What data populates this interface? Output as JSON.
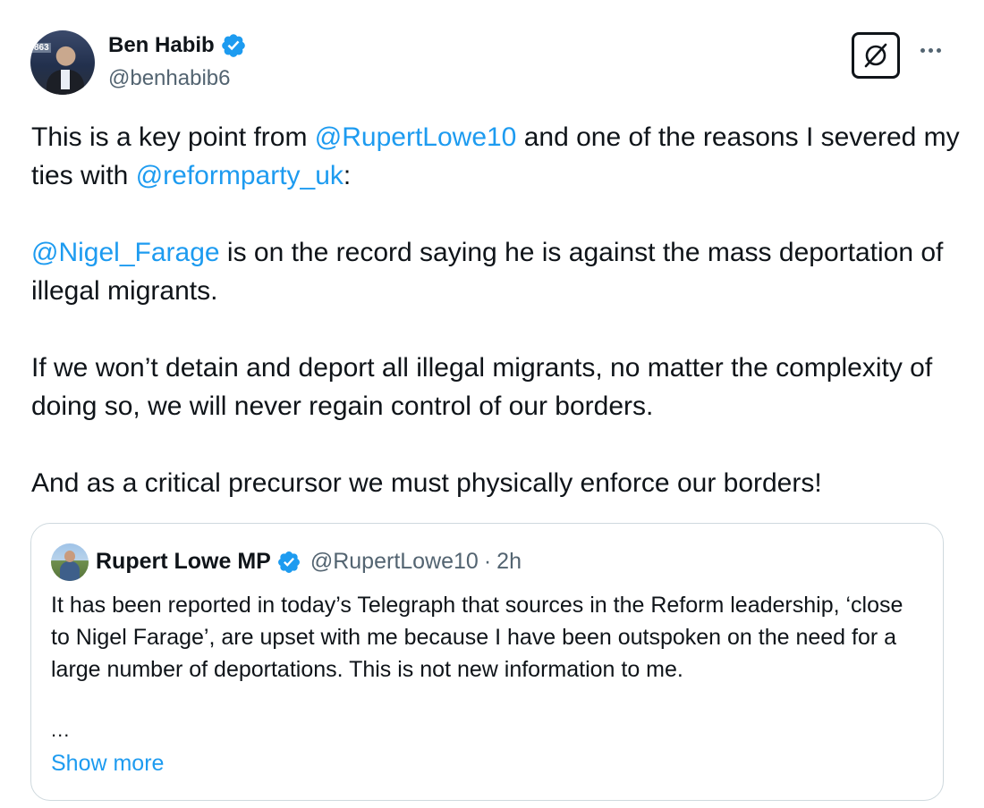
{
  "author": {
    "display_name": "Ben Habib",
    "handle": "@benhabib6",
    "avatar_icon": "profile-photo",
    "avatar_badge": "863",
    "verified_icon": "verified-badge-icon",
    "verified_color": "#1d9bf0"
  },
  "actions": {
    "grok_icon": "grok-icon",
    "more_icon": "more-options-icon"
  },
  "tweet": {
    "p1_text1": "This is a key point from ",
    "p1_mention1": "@RupertLowe10",
    "p1_text2": " and one of the reasons I severed my ties with ",
    "p1_mention2": "@reformparty_uk",
    "p1_text3": ":",
    "p2_mention": "@Nigel_Farage",
    "p2_text": " is on the record saying he is against the mass deportation of illegal migrants.",
    "p3_text": "If we won’t detain and deport all illegal migrants, no matter the complexity of doing so, we will never regain control of our borders.",
    "p4_text": "And as a critical precursor we must physically enforce our borders!"
  },
  "quoted_tweet": {
    "display_name": "Rupert Lowe MP",
    "handle": "@RupertLowe10",
    "separator": "·",
    "time": "2h",
    "text": "It has been reported in today’s Telegraph that sources in the Reform leadership, ‘close to Nigel Farage’, are upset with me because I have been outspoken on the need for a large number of deportations. This is not new information to me.",
    "ellipsis": "...",
    "show_more": "Show more"
  },
  "colors": {
    "link": "#1d9bf0",
    "text": "#0f1419",
    "secondary": "#536471",
    "border": "#cfd9de"
  }
}
